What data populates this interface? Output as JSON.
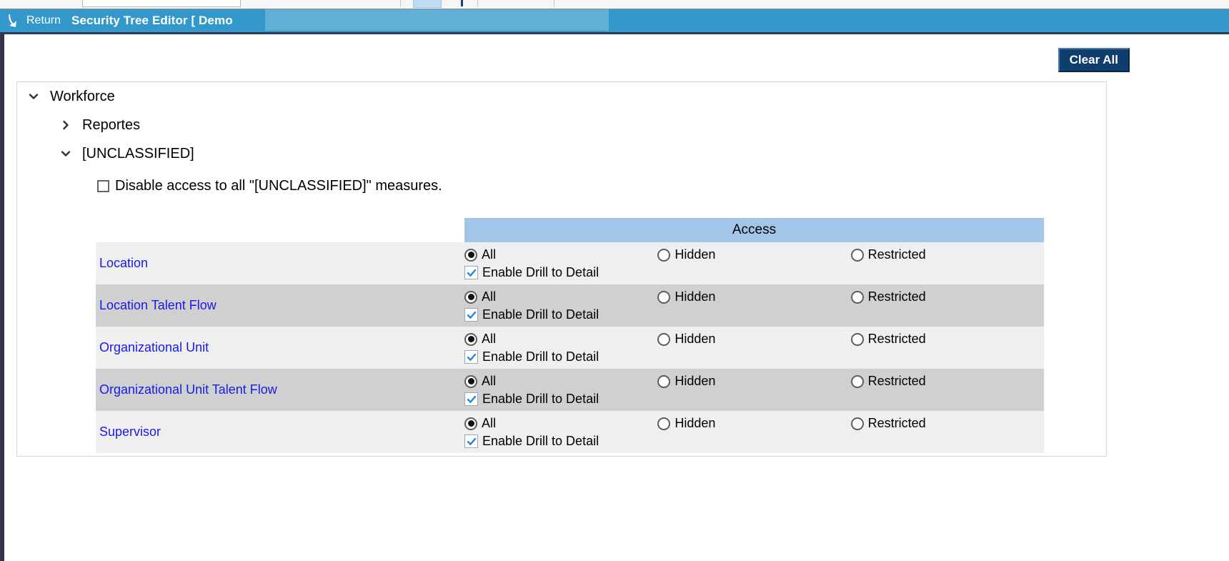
{
  "banner": {
    "return_label": "Return",
    "return_icon": "return-arrow-icon",
    "title": "Security Tree Editor [ Demo",
    "background_color": "#3399cc",
    "underline_color": "#2f3a55"
  },
  "toolbar": {
    "clear_all_label": "Clear All",
    "clear_all_color": "#0f3d6e"
  },
  "tree": {
    "nodes": [
      {
        "label": "Workforce",
        "icon": "chevron-down-icon",
        "expanded": true,
        "level": 0
      },
      {
        "label": "Reportes",
        "icon": "chevron-right-icon",
        "expanded": false,
        "level": 1
      },
      {
        "label": "[UNCLASSIFIED]",
        "icon": "chevron-down-icon",
        "expanded": true,
        "level": 1
      }
    ]
  },
  "disable_access": {
    "label": "Disable access to all \"[UNCLASSIFIED]\" measures.",
    "checked": false
  },
  "access_table": {
    "header": "Access",
    "header_color": "#a3c6e8",
    "options": {
      "all": "All",
      "hidden": "Hidden",
      "restricted": "Restricted",
      "drill": "Enable Drill to Detail"
    },
    "link_color": "#1a1ae6",
    "row_bg_odd": "#efefef",
    "row_bg_even": "#d0d0d0",
    "rows": [
      {
        "name": "Location",
        "access": "All",
        "drill_enabled": true
      },
      {
        "name": "Location Talent Flow",
        "access": "All",
        "drill_enabled": true
      },
      {
        "name": "Organizational Unit",
        "access": "All",
        "drill_enabled": true
      },
      {
        "name": "Organizational Unit Talent Flow",
        "access": "All",
        "drill_enabled": true
      },
      {
        "name": "Supervisor",
        "access": "All",
        "drill_enabled": true
      }
    ]
  }
}
